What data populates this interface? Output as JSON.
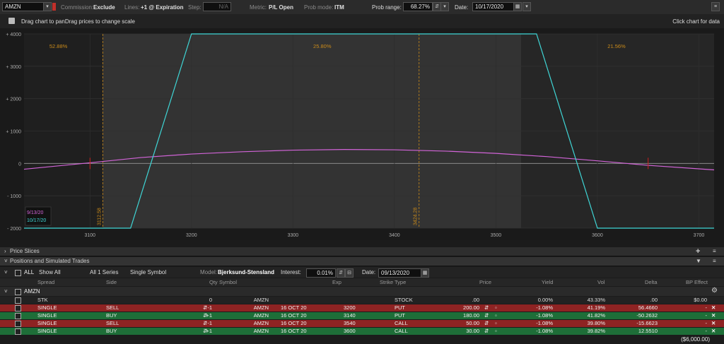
{
  "toolbar": {
    "symbol": "AMZN",
    "commission_label": "Commission:",
    "commission_value": "Exclude",
    "lines_label": "Lines:",
    "lines_value": "+1 @ Expiration",
    "step_label": "Step:",
    "step_value": "N/A",
    "metric_label": "Metric:",
    "metric_value": "P/L Open",
    "probmode_label": "Prob mode:",
    "probmode_value": "ITM",
    "probrange_label": "Prob range:",
    "probrange_value": "68.27%",
    "date_label": "Date:",
    "date_value": "10/17/2020"
  },
  "chart_header": {
    "hint": "Drag chart to panDrag prices to change scale",
    "click_hint": "Click chart for data"
  },
  "chart_data": {
    "type": "line",
    "x_ticks": [
      "3100",
      "3200",
      "3300",
      "3400",
      "3500",
      "3600",
      "3700"
    ],
    "y_ticks": [
      "+ 4000",
      "+ 3000",
      "+ 2000",
      "+ 1000",
      "0",
      "- 1000",
      "- 2000"
    ],
    "xlim": [
      3035,
      3715
    ],
    "ylim": [
      -2000,
      4000
    ],
    "series": [
      {
        "name": "9/13/20",
        "color": "#d264d8",
        "x": [
          3035,
          3100,
          3150,
          3200,
          3250,
          3300,
          3350,
          3400,
          3450,
          3500,
          3550,
          3600,
          3650,
          3715
        ],
        "y": [
          -180,
          20,
          180,
          290,
          360,
          410,
          430,
          420,
          380,
          310,
          210,
          80,
          -60,
          -200
        ]
      },
      {
        "name": "10/17/20",
        "color": "#3fd6d6",
        "x": [
          3035,
          3140,
          3200,
          3540,
          3600,
          3715
        ],
        "y": [
          -2000,
          -2000,
          4000,
          4000,
          -2000,
          -2000
        ]
      }
    ],
    "probabilities": [
      "52.88%",
      "25.80%",
      "21.56%"
    ],
    "prob_lines": [
      "3112.58",
      "3424.28"
    ],
    "legend": [
      "9/13/20",
      "10/17/20"
    ]
  },
  "price_slices": {
    "label": "Price Slices"
  },
  "positions": {
    "title": "Positions and Simulated Trades",
    "filter": {
      "all_label": "ALL",
      "show_all": "Show All",
      "all_series": "All 1 Series",
      "single_symbol": "Single Symbol",
      "model_label": "Model:",
      "model_value": "Bjerksund-Stensland",
      "interest_label": "Interest:",
      "interest_value": "0.01%",
      "date_label": "Date:",
      "date_value": "09/13/2020"
    },
    "columns": [
      "Spread",
      "Side",
      "Qty",
      "Symbol",
      "Exp",
      "Strike",
      "Type",
      "Price",
      "Yield",
      "Vol",
      "Delta",
      "BP Effect"
    ],
    "group": "AMZN",
    "rows": [
      {
        "spread": "STK",
        "side": "",
        "qty": "0",
        "symbol": "AMZN",
        "exp": "",
        "strike": "",
        "type": "STOCK",
        "price": ".00",
        "yield": "0.00%",
        "vol": "43.33%",
        "delta": ".00",
        "bp": "$0.00",
        "color": "#222222"
      },
      {
        "spread": "SINGLE",
        "side": "SELL",
        "qty": "-1",
        "symbol": "AMZN",
        "exp": "16 OCT 20",
        "strike": "3200",
        "type": "PUT",
        "price": "200.00",
        "yield": "-1.08%",
        "vol": "41.19%",
        "delta": "56.4660",
        "bp": "-",
        "color": "#8e2323"
      },
      {
        "spread": "SINGLE",
        "side": "BUY",
        "qty": "+1",
        "symbol": "AMZN",
        "exp": "16 OCT 20",
        "strike": "3140",
        "type": "PUT",
        "price": "180.00",
        "yield": "-1.08%",
        "vol": "41.82%",
        "delta": "-50.2632",
        "bp": "-",
        "color": "#1e6e38"
      },
      {
        "spread": "SINGLE",
        "side": "SELL",
        "qty": "-1",
        "symbol": "AMZN",
        "exp": "16 OCT 20",
        "strike": "3540",
        "type": "CALL",
        "price": "50.00",
        "yield": "-1.08%",
        "vol": "39.80%",
        "delta": "-15.6623",
        "bp": "-",
        "color": "#8e2323"
      },
      {
        "spread": "SINGLE",
        "side": "BUY",
        "qty": "+1",
        "symbol": "AMZN",
        "exp": "16 OCT 20",
        "strike": "3600",
        "type": "CALL",
        "price": "30.00",
        "yield": "-1.08%",
        "vol": "39.82%",
        "delta": "12.5510",
        "bp": "-",
        "color": "#1e6e38"
      }
    ],
    "total_bp": "($6,000.00)"
  },
  "colors": {
    "accent_cyan": "#3fd6d6",
    "accent_magenta": "#d264d8",
    "sell_red": "#8e2323",
    "buy_green": "#1e6e38"
  }
}
